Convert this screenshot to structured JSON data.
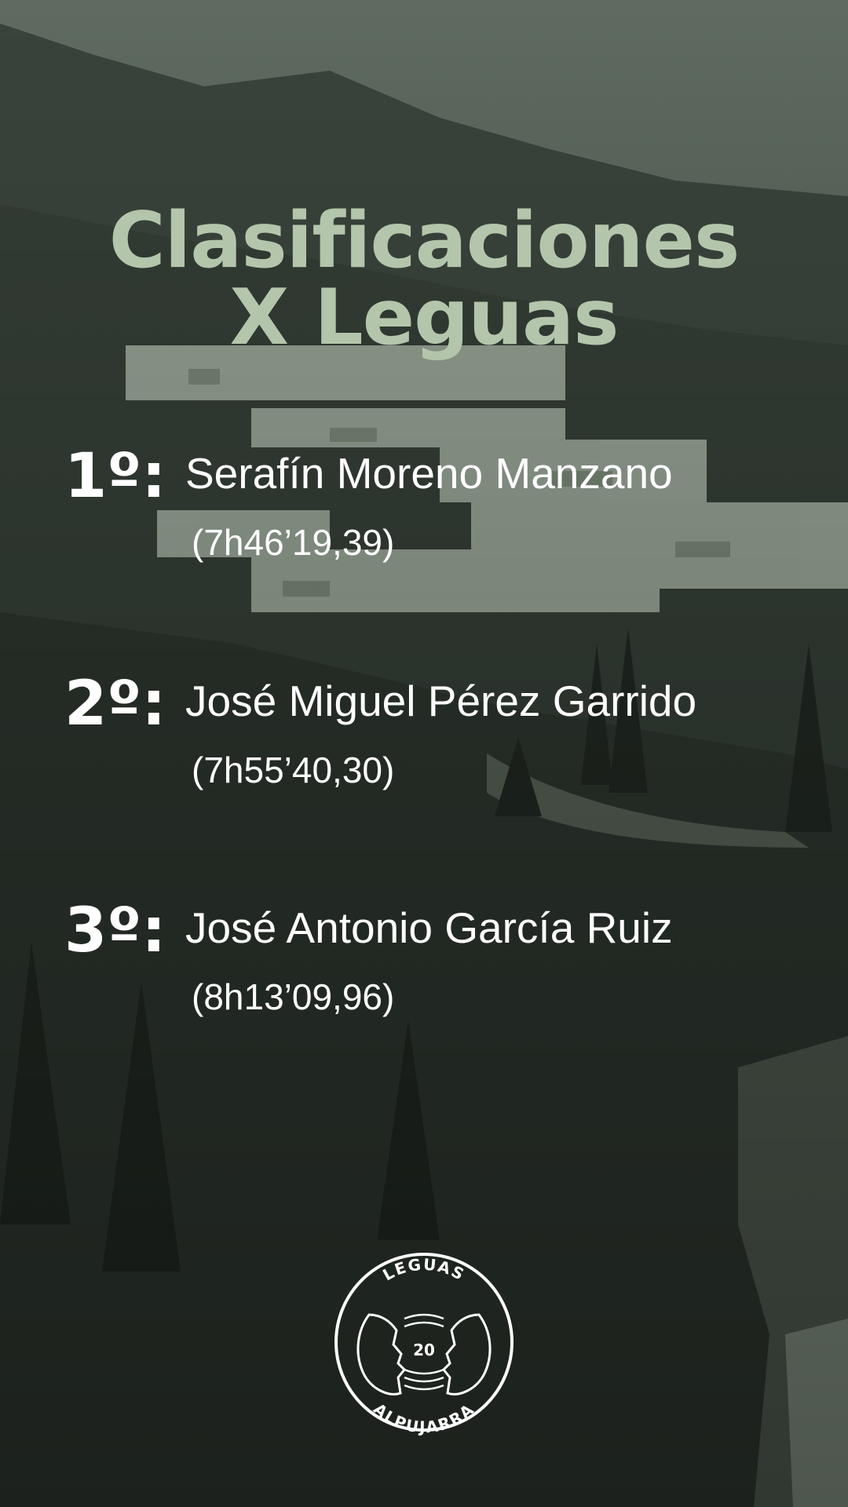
{
  "title": {
    "line1": "Clasificaciones",
    "line2": "X Leguas"
  },
  "results": [
    {
      "rank": "1º:",
      "name": "Serafín Moreno Manzano",
      "time": "(7h46’19,39)"
    },
    {
      "rank": "2º:",
      "name": "José Miguel Pérez Garrido",
      "time": "(7h55’40,30)"
    },
    {
      "rank": "3º:",
      "name": "José Antonio García Ruiz",
      "time": "(8h13’09,96)"
    }
  ],
  "logo": {
    "top_text": "LEGUAS",
    "center_text": "20",
    "bottom_text": "ALPUJARRA"
  },
  "colors": {
    "title": "#b3c6ab",
    "text": "#ffffff",
    "background": "#2c332d"
  }
}
